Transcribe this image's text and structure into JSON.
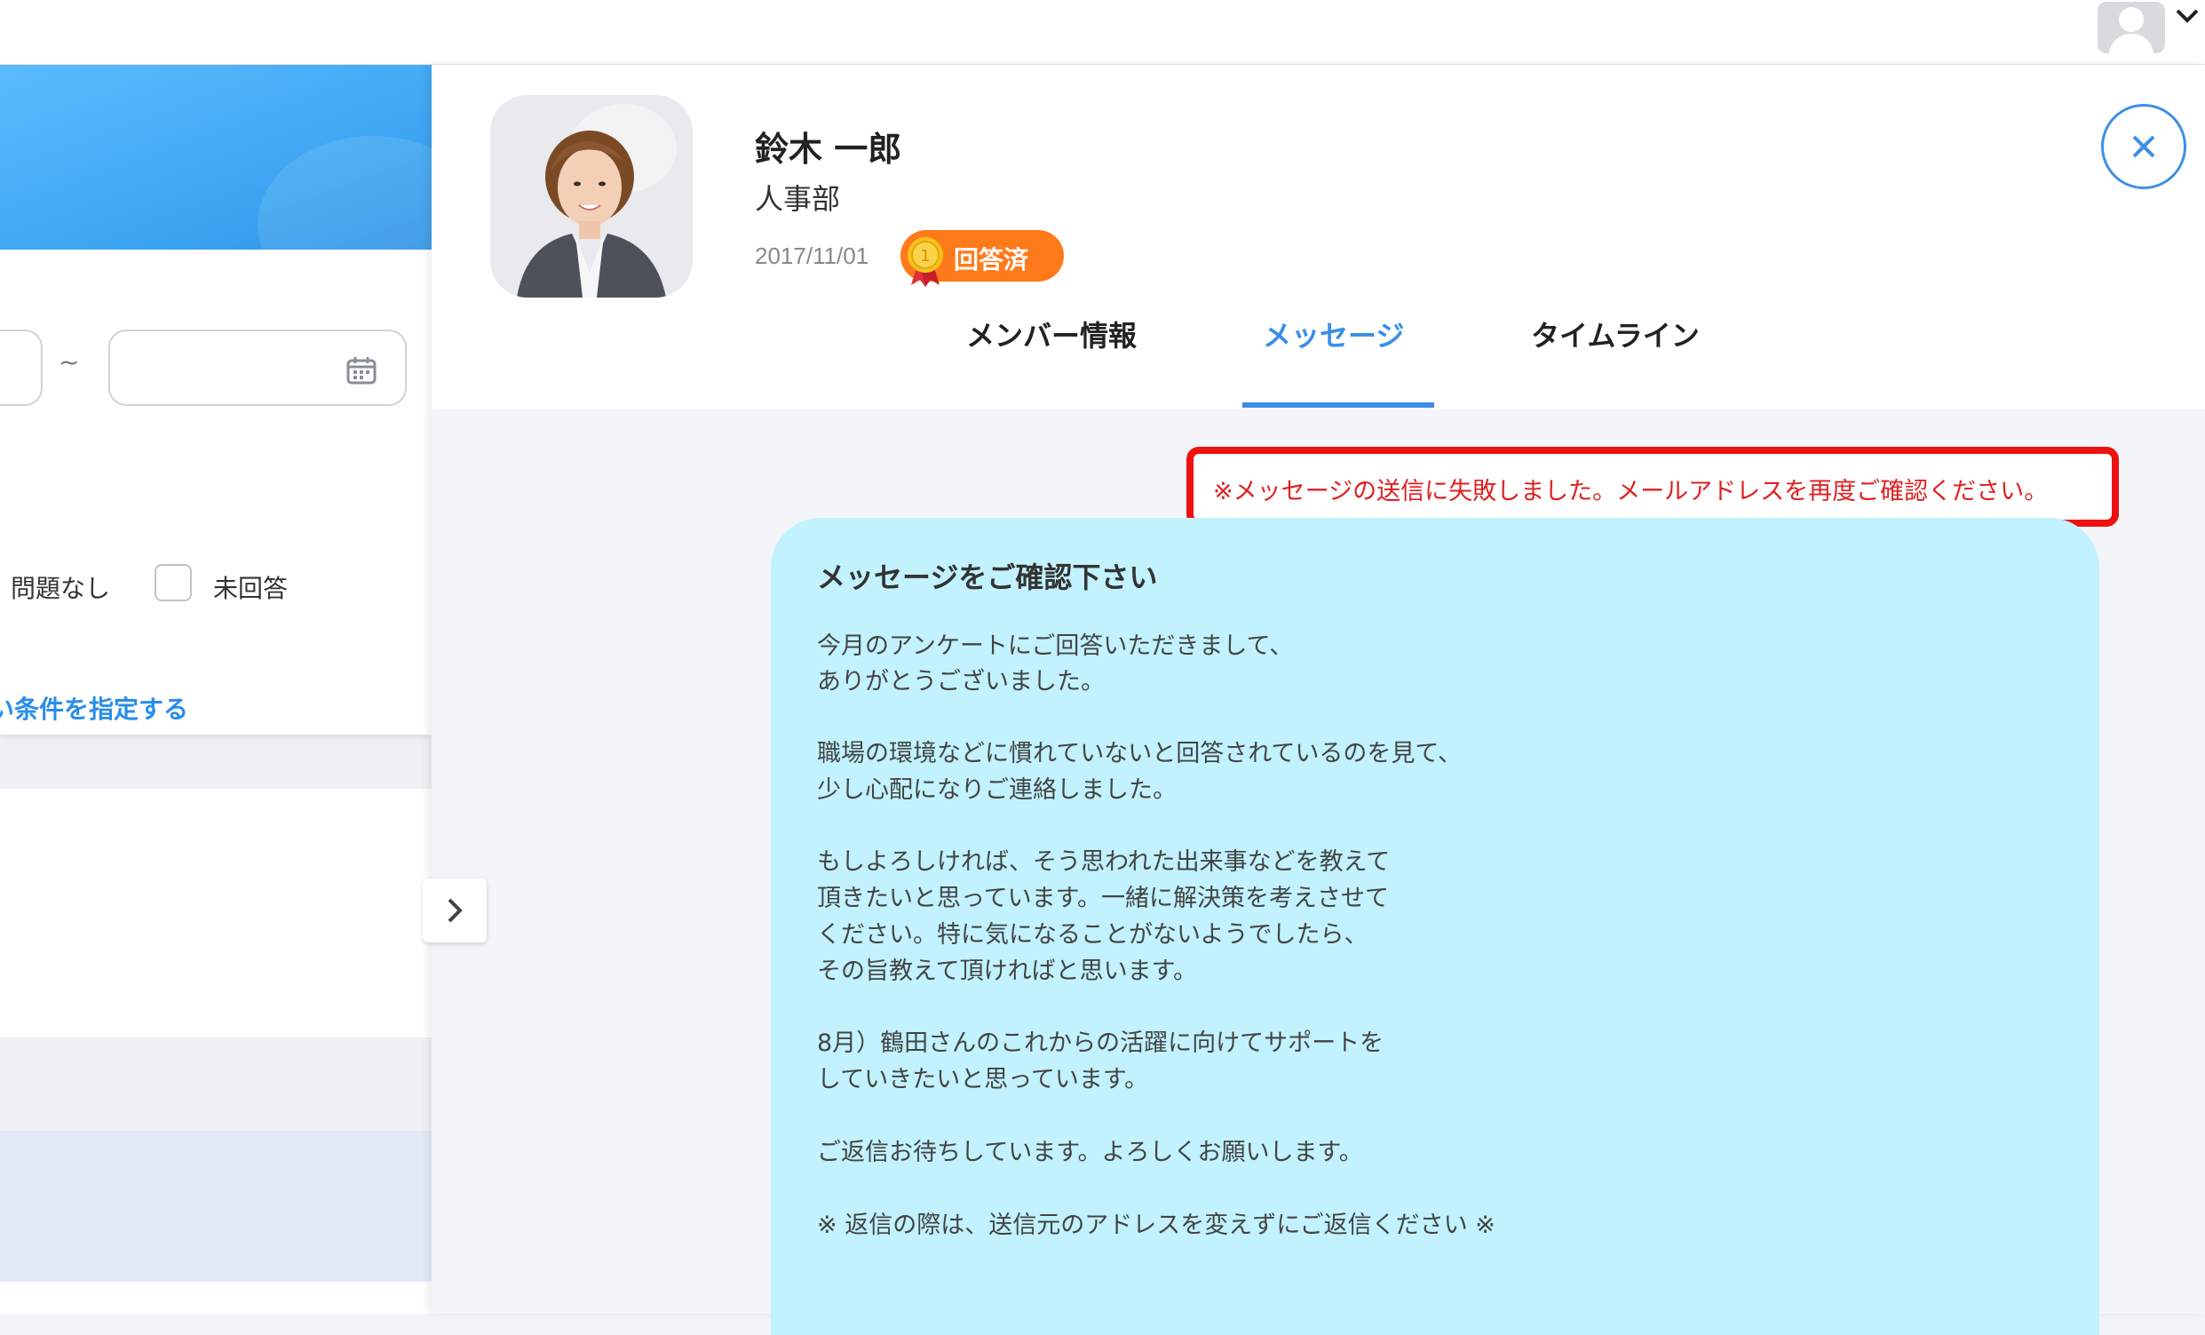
{
  "member": {
    "name": "鈴木 一郎",
    "department": "人事部",
    "date": "2017/11/01",
    "status": "回答済"
  },
  "tabs": {
    "member_info": "メンバー情報",
    "message": "メッセージ",
    "timeline": "タイムライン"
  },
  "filter": {
    "range_separator": "~",
    "option_no_problem": "問題なし",
    "option_unanswered": "未回答",
    "advanced_link": "い条件を指定する"
  },
  "error": {
    "text": "※メッセージの送信に失敗しました。メールアドレスを再度ご確認ください。"
  },
  "message": {
    "title": "メッセージをご確認下さい",
    "lines": [
      "今月のアンケートにご回答いただきまして、",
      "ありがとうございました。",
      "職場の環境などに慣れていないと回答されているのを見て、",
      "少し心配になりご連絡しました。",
      "もしよろしければ、そう思われた出来事などを教えて",
      "頂きたいと思っています。一緒に解決策を考えさせて",
      "ください。特に気になることがないようでしたら、",
      "その旨教えて頂ければと思います。",
      "8月）鶴田さんのこれからの活躍に向けてサポートを",
      "していきたいと思っています。",
      "ご返信お待ちしています。よろしくお願いします。",
      "※ 返信の際は、送信元のアドレスを変えずにご返信ください ※"
    ]
  },
  "colors": {
    "accent": "#3a8ee6",
    "badge": "#ff7a1a",
    "error": "#e02020",
    "bubble": "#c1f2fd",
    "banner": "#4fb3fb"
  },
  "icons": {
    "user": "user-avatar-icon",
    "chevron": "chevron-down-icon",
    "calendar": "calendar-icon",
    "medal": "medal-icon",
    "close": "close-icon",
    "collapse": "chevron-right-icon"
  }
}
